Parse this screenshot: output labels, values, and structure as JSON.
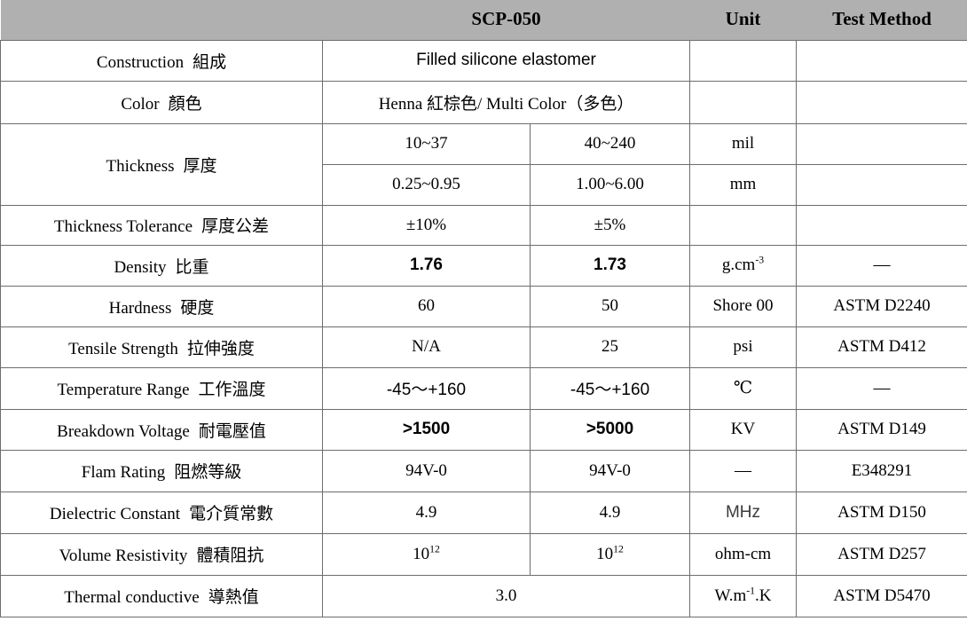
{
  "header": {
    "blank_label": "",
    "product": "SCP-050",
    "unit": "Unit",
    "test_method": "Test Method"
  },
  "rows": [
    {
      "label_en": "Construction",
      "label_zh": "組成",
      "value_merged": "Filled silicone elastomer",
      "value_1": "",
      "value_2": "",
      "unit": "",
      "test": ""
    },
    {
      "label_en": "Color",
      "label_zh": "顏色",
      "value_merged": "Henna 紅棕色/ Multi Color（多色）",
      "value_1": "",
      "value_2": "",
      "unit": "",
      "test": ""
    },
    {
      "label_en": "Thickness",
      "label_zh": "厚度",
      "value_1": "10~37",
      "value_2": "40~240",
      "unit": "mil",
      "test": ""
    },
    {
      "label_en": "",
      "label_zh": "",
      "value_1": "0.25~0.95",
      "value_2": "1.00~6.00",
      "unit": "mm",
      "test": ""
    },
    {
      "label_en": "Thickness Tolerance",
      "label_zh": "厚度公差",
      "value_1": "±10%",
      "value_2": "±5%",
      "unit": "",
      "test": ""
    },
    {
      "label_en": "Density",
      "label_zh": "比重",
      "value_1": "1.76",
      "value_2": "1.73",
      "unit_base": "g.cm",
      "unit_sup": "-3",
      "test": "—"
    },
    {
      "label_en": "Hardness",
      "label_zh": "硬度",
      "value_1": "60",
      "value_2": "50",
      "unit": "Shore 00",
      "test": "ASTM D2240"
    },
    {
      "label_en": "Tensile Strength",
      "label_zh": "拉伸強度",
      "value_1": "N/A",
      "value_2": "25",
      "unit": "psi",
      "test": "ASTM D412"
    },
    {
      "label_en": "Temperature Range",
      "label_zh": "工作溫度",
      "value_1": "-45～+160",
      "value_2": "-45～+160",
      "unit": "℃",
      "test": "—"
    },
    {
      "label_en": "Breakdown Voltage",
      "label_zh": "耐電壓值",
      "value_1": ">1500",
      "value_2": ">5000",
      "unit": "KV",
      "test": "ASTM D149"
    },
    {
      "label_en": "Flam Rating",
      "label_zh": "阻燃等級",
      "value_1": "94V-0",
      "value_2": "94V-0",
      "unit": "—",
      "test": "E348291"
    },
    {
      "label_en": "Dielectric Constant",
      "label_zh": "電介質常數",
      "value_1": "4.9",
      "value_2": "4.9",
      "unit": "MHz",
      "test": "ASTM D150"
    },
    {
      "label_en": "Volume Resistivity",
      "label_zh": "體積阻抗",
      "value_1_base": "10",
      "value_1_sup": "12",
      "value_2_base": "10",
      "value_2_sup": "12",
      "unit": "ohm-cm",
      "test": "ASTM D257"
    },
    {
      "label_en": "Thermal conductive",
      "label_zh": "導熱值",
      "value_merged": "3.0",
      "unit_base": "W.m",
      "unit_sup": "-1",
      "unit_tail": ".K",
      "test": "ASTM D5470"
    }
  ],
  "colors": {
    "header_background": "#b0b0b0",
    "border": "#6d6d6d",
    "text": "#000000",
    "page_background": "#ffffff"
  }
}
